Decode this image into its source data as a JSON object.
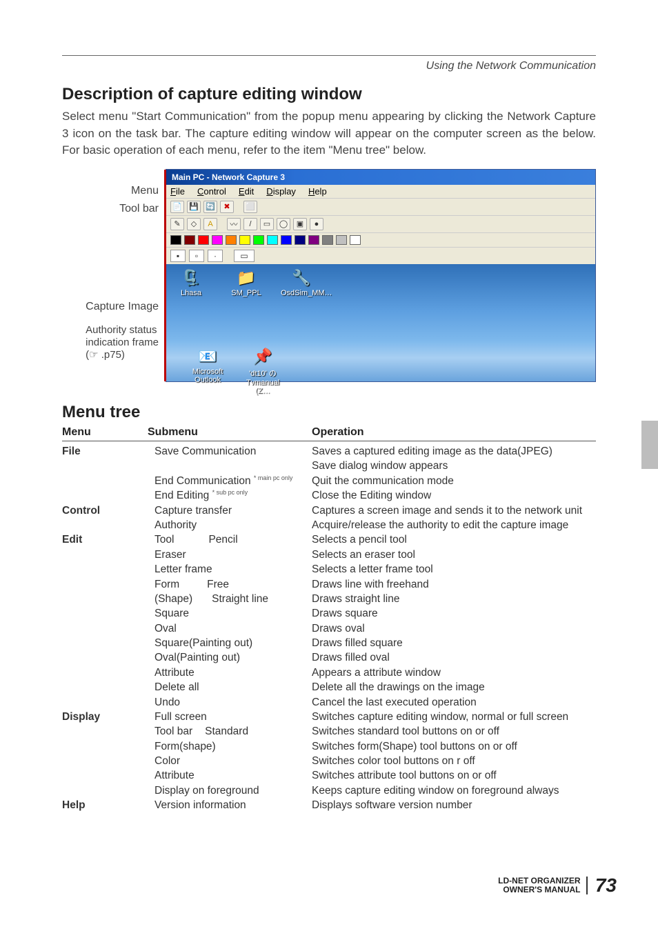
{
  "header": {
    "section": "Using the Network Communication"
  },
  "title1": "Description of capture editing window",
  "intro": "Select menu \"Start Communication\" from the popup menu appearing by clicking  the Network Capture 3 icon on the task bar. The capture editing window will appear on the computer screen as the below. For basic operation of each menu, refer to the item \"Menu tree\" below.",
  "diagram_labels": {
    "menu": "Menu",
    "toolbar": "Tool bar",
    "capture": "Capture Image",
    "auth1": "Authority status",
    "auth2": "indication frame",
    "auth3": "(☞ .p75)"
  },
  "app": {
    "title": "Main PC - Network Capture 3",
    "menus": {
      "file": "File",
      "control": "Control",
      "edit": "Edit",
      "display": "Display",
      "help": "Help"
    },
    "toolbar_icons": [
      "📄",
      "💾",
      "🔄",
      "✖",
      "⬜",
      "/",
      "◯",
      "A",
      "〰",
      "/",
      "▭",
      "◯",
      "▣",
      "●"
    ],
    "colors": [
      "#000000",
      "#800000",
      "#ff0000",
      "#ff00ff",
      "#ff8000",
      "#ffff00",
      "#00ff00",
      "#00ffff",
      "#0000ff",
      "#000080",
      "#800080",
      "#808080",
      "#c0c0c0",
      "#ffffff"
    ],
    "attr_boxes": [
      "▪",
      "▫",
      "·",
      "▭"
    ],
    "desktop_icons": {
      "lhasa": "Lhasa",
      "smppl": "SM_PPL",
      "osdsim": "OsdSim_MM…",
      "outlook": "Microsoft Outlook",
      "dt10": "'dt10' の Tvmanual (Z…"
    }
  },
  "title2": "Menu tree",
  "headings": {
    "menu": "Menu",
    "sub": "Submenu",
    "op": "Operation"
  },
  "tree": {
    "file": {
      "label": "File",
      "r1s": "Save Communication",
      "r1o": "Saves a captured editing image as the data(JPEG)",
      "r1o2": "Save dialog window appears",
      "r2s": "End Communication",
      "r2n": "* main pc only",
      "r2o": "Quit the communication mode",
      "r3s": "End Editing",
      "r3n": "* sub pc only",
      "r3o": "Close the Editing window"
    },
    "control": {
      "label": "Control",
      "r1s": "Capture transfer",
      "r1o": "Captures a screen image and sends it to the network unit",
      "r2s": "Authority",
      "r2o": "Acquire/release the authority to edit the capture image"
    },
    "edit": {
      "label": "Edit",
      "tool": "Tool",
      "t1s": "Pencil",
      "t1o": "Selects a pencil tool",
      "t2s": "Eraser",
      "t2o": "Selects an eraser tool",
      "t3s": "Letter frame",
      "t3o": "Selects a letter frame tool",
      "form": "Form",
      "shape": "(Shape)",
      "f1s": "Free",
      "f1o": "Draws line with freehand",
      "f2s": "Straight line",
      "f2o": "Draws straight line",
      "f3s": "Square",
      "f3o": "Draws square",
      "f4s": "Oval",
      "f4o": "Draws oval",
      "f5s": "Square(Painting out)",
      "f5o": "Draws filled square",
      "f6s": "Oval(Painting out)",
      "f6o": "Draws filled oval",
      "a1s": "Attribute",
      "a1o": "Appears a attribute window",
      "a2s": "Delete all",
      "a2o": "Delete all the drawings on the image",
      "a3s": "Undo",
      "a3o": "Cancel the last executed operation"
    },
    "display": {
      "label": "Display",
      "r1s": "Full screen",
      "r1o": "Switches capture editing window, normal or full screen",
      "tb": "Tool bar",
      "tb1s": "Standard",
      "tb1o": "Switches standard tool buttons on or off",
      "tb2s": "Form(shape)",
      "tb2o": "Switches form(Shape) tool buttons on or off",
      "tb3s": "Color",
      "tb3o": "Switches color tool buttons on r off",
      "tb4s": "Attribute",
      "tb4o": "Switches attribute tool buttons on or off",
      "r2s": "Display on foreground",
      "r2o": "Keeps capture editing window on foreground always"
    },
    "help": {
      "label": "Help",
      "r1s": "Version information",
      "r1o": "Displays software version number"
    }
  },
  "footer": {
    "line1": "LD-NET ORGANIZER",
    "line2": "OWNER'S MANUAL",
    "page": "73"
  }
}
